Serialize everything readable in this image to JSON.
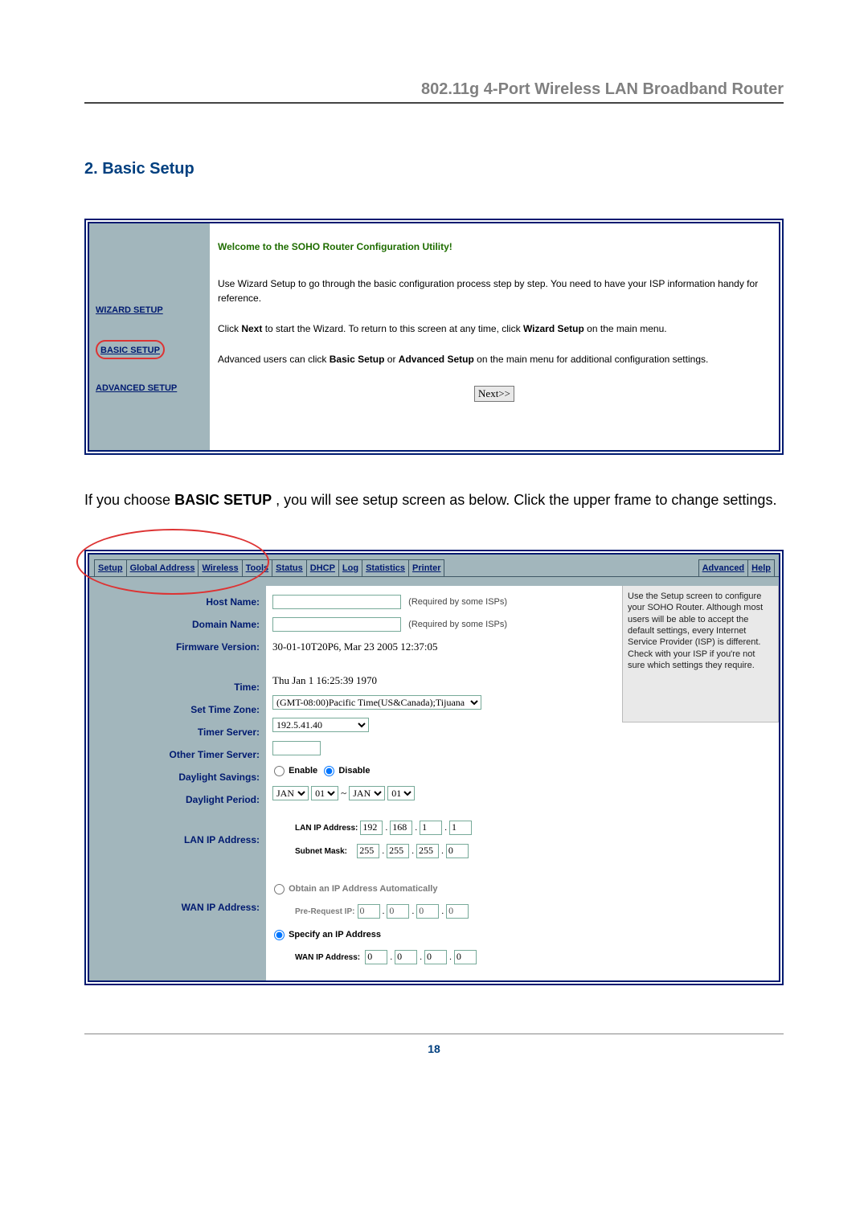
{
  "header": {
    "title": "802.11g 4-Port Wireless LAN Broadband Router"
  },
  "section": {
    "title": "2. Basic Setup"
  },
  "shot1": {
    "nav": {
      "wizard": "WIZARD SETUP",
      "basic": "BASIC SETUP",
      "advanced": "ADVANCED SETUP"
    },
    "welcome": "Welcome to the SOHO Router Configuration Utility!",
    "p1": "Use Wizard Setup to go through the basic configuration process step by step. You need to have your ISP information handy for reference.",
    "p2a": "Click ",
    "p2b": "Next",
    "p2c": " to start the Wizard. To return to this screen at any time, click ",
    "p2d": "Wizard Setup",
    "p2e": " on the main menu.",
    "p3a": "Advanced users can click ",
    "p3b": "Basic Setup",
    "p3c": " or ",
    "p3d": "Advanced Setup",
    "p3e": " on the main menu for additional configuration settings.",
    "next": "Next>>"
  },
  "body": {
    "t1": "If you choose ",
    "t2": "BASIC SETUP",
    "t3": " , you will see setup screen as below. Click the upper frame to change settings."
  },
  "tabs": {
    "setup": "Setup",
    "global": "Global Address",
    "wireless": "Wireless",
    "tools": "Tools",
    "status": "Status",
    "dhcp": "DHCP",
    "log": "Log",
    "statistics": "Statistics",
    "printer": "Printer",
    "advanced": "Advanced",
    "help": "Help"
  },
  "labels": {
    "host": "Host Name:",
    "domain": "Domain Name:",
    "fw": "Firmware Version:",
    "time": "Time:",
    "zone": "Set Time Zone:",
    "ts": "Timer Server:",
    "ots": "Other Timer Server:",
    "ds": "Daylight Savings:",
    "dp": "Daylight Period:",
    "lan": "LAN IP Address:",
    "wan": "WAN IP Address:"
  },
  "values": {
    "required": "(Required by some ISPs)",
    "firmware": "30-01-10T20P6, Mar 23 2005 12:37:05",
    "time": "Thu Jan 1 16:25:39 1970",
    "zone": "(GMT-08:00)Pacific Time(US&Canada);Tijuana",
    "timer": "192.5.41.40",
    "enable": "Enable",
    "disable": "Disable",
    "jan": "JAN",
    "d01": "01",
    "lanLabel": "LAN IP Address:",
    "subnetLabel": "Subnet Mask:",
    "lan": [
      "192",
      "168",
      "1",
      "1"
    ],
    "subnet": [
      "255",
      "255",
      "255",
      "0"
    ],
    "obtain": "Obtain an IP Address Automatically",
    "preReq": "Pre-Request IP:",
    "pre": [
      "0",
      "0",
      "0",
      "0"
    ],
    "specify": "Specify an IP Address",
    "wanLabel": "WAN IP Address:",
    "wan": [
      "0",
      "0",
      "0",
      "0"
    ]
  },
  "sidehelp": "Use the Setup screen to configure your SOHO Router. Although most users will be able to accept the default settings, every Internet Service Provider (ISP) is different. Check with your ISP if you're not sure which settings they require.",
  "page": {
    "num": "18"
  }
}
